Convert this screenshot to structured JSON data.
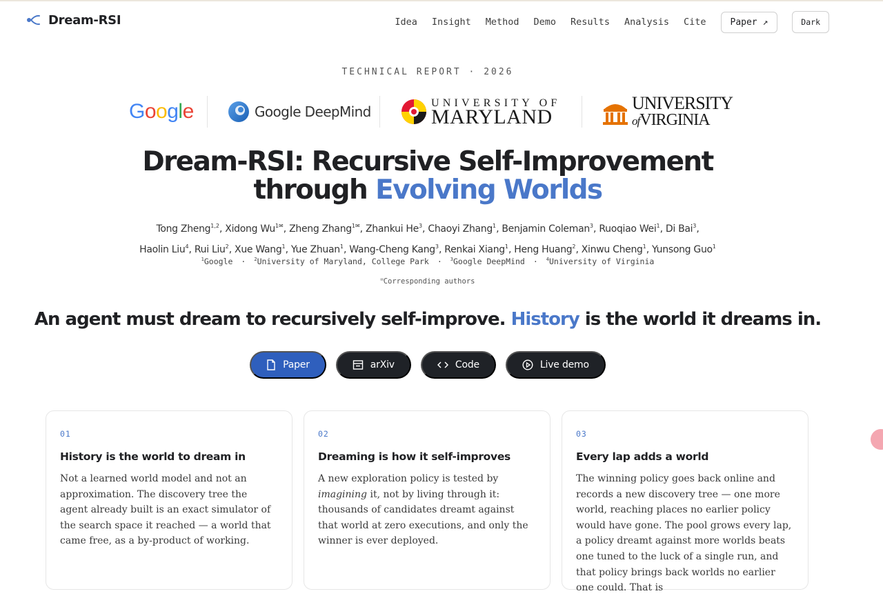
{
  "nav": {
    "brand": "Dream-RSI",
    "links": [
      "Idea",
      "Insight",
      "Method",
      "Demo",
      "Results",
      "Analysis",
      "Cite"
    ],
    "paper_button": "Paper ↗",
    "theme_button": "Dark"
  },
  "header": {
    "eyebrow": "TECHNICAL REPORT · 2026",
    "logos": {
      "google": [
        "G",
        "o",
        "o",
        "g",
        "l",
        "e"
      ],
      "deepmind": "Google DeepMind",
      "umd_line1": "UNIVERSITY OF",
      "umd_line2": "MARYLAND",
      "uva_line1": "UNIVERSITY",
      "uva_of": "of",
      "uva_line2": "VIRGINIA"
    },
    "title_part1": "Dream-RSI: Recursive Self-Improvement",
    "title_part2": "through",
    "title_accent": "Evolving Worlds"
  },
  "authors": {
    "line1": [
      {
        "name": "Tong Zheng",
        "sup": "1,2"
      },
      {
        "name": "Xidong Wu",
        "sup": "1✉"
      },
      {
        "name": "Zheng Zhang",
        "sup": "1✉"
      },
      {
        "name": "Zhankui He",
        "sup": "3"
      },
      {
        "name": "Chaoyi Zhang",
        "sup": "1"
      },
      {
        "name": "Benjamin Coleman",
        "sup": "3"
      },
      {
        "name": "Ruoqiao Wei",
        "sup": "1"
      },
      {
        "name": "Di Bai",
        "sup": "3"
      }
    ],
    "line2": [
      {
        "name": "Haolin Liu",
        "sup": "4"
      },
      {
        "name": "Rui Liu",
        "sup": "2"
      },
      {
        "name": "Xue Wang",
        "sup": "1"
      },
      {
        "name": "Yue Zhuan",
        "sup": "1"
      },
      {
        "name": "Wang-Cheng Kang",
        "sup": "3"
      },
      {
        "name": "Renkai Xiang",
        "sup": "1"
      },
      {
        "name": "Heng Huang",
        "sup": "2"
      },
      {
        "name": "Xinwu Cheng",
        "sup": "1"
      },
      {
        "name": "Yunsong Guo",
        "sup": "1"
      }
    ],
    "affiliations": [
      {
        "sup": "1",
        "name": "Google"
      },
      {
        "sup": "2",
        "name": "University of Maryland, College Park"
      },
      {
        "sup": "3",
        "name": "Google DeepMind"
      },
      {
        "sup": "4",
        "name": "University of Virginia"
      }
    ],
    "corresponding_sup": "✉",
    "corresponding": "Corresponding authors"
  },
  "tagline": {
    "part1": "An agent must dream to recursively self-improve.",
    "accent": "History",
    "part2": "is the world it dreams in."
  },
  "ctas": [
    {
      "label": "Paper",
      "icon": "document-icon"
    },
    {
      "label": "arXiv",
      "icon": "archive-icon"
    },
    {
      "label": "Code",
      "icon": "code-icon"
    },
    {
      "label": "Live demo",
      "icon": "play-circle-icon"
    }
  ],
  "cards": [
    {
      "num": "01",
      "title": "History is the world to dream in",
      "body_pre": "Not a learned world model and not an approximation. The discovery tree the agent already built is an ",
      "body_em": "exact",
      "body_post": " simulator of the search space it reached — a world that came free, as a by-product of working."
    },
    {
      "num": "02",
      "title": "Dreaming is how it self-improves",
      "body_pre": "A new exploration policy is tested by ",
      "body_em": "imagining",
      "body_post": " it, not by living through it: thousands of candidates dreamt against that world at zero executions, and only the winner is ever deployed."
    },
    {
      "num": "03",
      "title": "Every lap adds a world",
      "body_pre": "The winning policy goes back online and records a new discovery tree — one more world, reaching places no earlier policy would have gone. The pool grows every lap, a policy dreamt against more worlds beats one tuned to the luck of a single run, and that policy brings back worlds no earlier one could. That is",
      "body_em": "",
      "body_post": ""
    }
  ],
  "colors": {
    "accent": "#4a78c9",
    "primary_button": "#2f5fbd",
    "dark_button": "#1f2227"
  }
}
